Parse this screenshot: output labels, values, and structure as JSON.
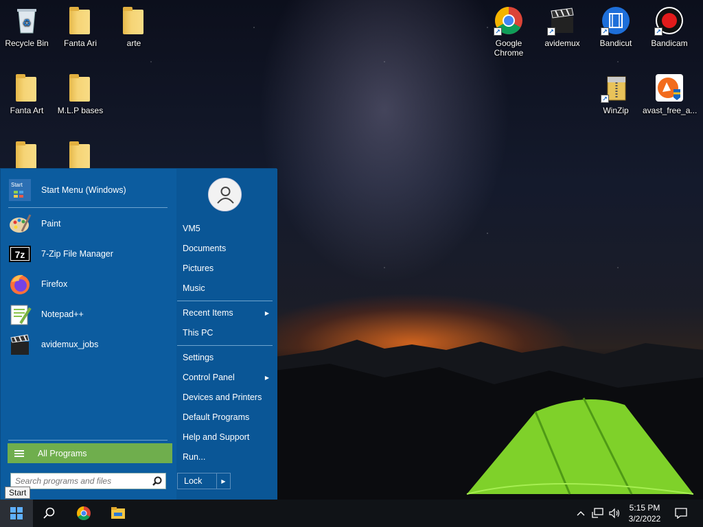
{
  "desktop": {
    "icons_left": [
      {
        "label": "Recycle Bin",
        "icon": "recycle-bin-icon"
      },
      {
        "label": "Fanta Ari",
        "icon": "folder-icon"
      },
      {
        "label": "arte",
        "icon": "folder-icon"
      },
      {
        "label": "Fanta Art",
        "icon": "folder-icon"
      },
      {
        "label": "M.L.P bases",
        "icon": "folder-icon"
      }
    ],
    "icons_right": [
      {
        "label": "Google Chrome",
        "icon": "chrome-icon"
      },
      {
        "label": "avidemux",
        "icon": "clapperboard-icon"
      },
      {
        "label": "Bandicut",
        "icon": "film-icon"
      },
      {
        "label": "Bandicam",
        "icon": "record-icon"
      },
      {
        "label": "WinZip",
        "icon": "winzip-icon"
      },
      {
        "label": "avast_free_a...",
        "icon": "avast-icon"
      }
    ]
  },
  "start_menu": {
    "pinned": {
      "label": "Start Menu (Windows)",
      "icon": "start-menu-icon"
    },
    "programs": [
      {
        "label": "Paint",
        "icon": "paint-palette-icon"
      },
      {
        "label": "7-Zip File Manager",
        "icon": "seven-zip-icon"
      },
      {
        "label": "Firefox",
        "icon": "firefox-icon"
      },
      {
        "label": "Notepad++",
        "icon": "notepad-plus-plus-icon"
      },
      {
        "label": "avidemux_jobs",
        "icon": "clapperboard-icon"
      }
    ],
    "all_programs_label": "All Programs",
    "search": {
      "placeholder": "Search programs and files"
    },
    "right_items": {
      "user": "VM5",
      "documents": "Documents",
      "pictures": "Pictures",
      "music": "Music",
      "recent_items": "Recent Items",
      "this_pc": "This PC",
      "settings": "Settings",
      "control_panel": "Control Panel",
      "devices_printers": "Devices and Printers",
      "default_programs": "Default Programs",
      "help_support": "Help and Support",
      "run": "Run..."
    },
    "lock_label": "Lock"
  },
  "tooltip": "Start",
  "taskbar": {
    "clock_time": "5:15 PM",
    "clock_date": "3/2/2022"
  },
  "colors": {
    "menu_blue": "#0c5c9f",
    "all_programs_green": "#6fae4d",
    "taskbar": "#101317"
  }
}
